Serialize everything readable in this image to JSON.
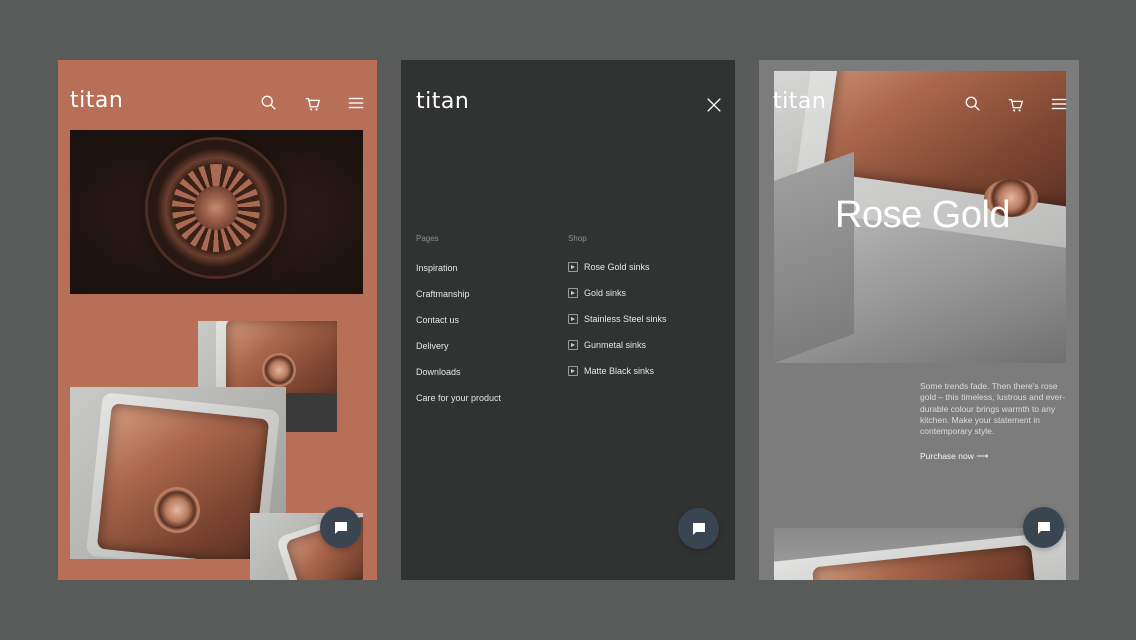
{
  "brand": {
    "logo_text": "titan"
  },
  "panel_product_gallery": {
    "background_color": "#b86f57",
    "icons": [
      "search-icon",
      "cart-icon",
      "hamburger-menu-icon",
      "chat-icon"
    ]
  },
  "panel_menu": {
    "background_color": "#313232",
    "pages_heading": "Pages",
    "pages": [
      {
        "label": "Inspiration"
      },
      {
        "label": "Craftmanship"
      },
      {
        "label": "Contact us"
      },
      {
        "label": "Delivery"
      },
      {
        "label": "Downloads"
      },
      {
        "label": "Care for your product"
      }
    ],
    "shop_heading": "Shop",
    "shop": [
      {
        "label": "Rose Gold sinks"
      },
      {
        "label": "Gold sinks"
      },
      {
        "label": "Stainless Steel sinks"
      },
      {
        "label": "Gunmetal sinks"
      },
      {
        "label": "Matte Black sinks"
      }
    ],
    "icons": [
      "close-icon",
      "chat-icon"
    ]
  },
  "panel_product_detail": {
    "background_color": "#7b7c7b",
    "hero_title": "Rose Gold",
    "description": "Some trends fade. Then there's rose gold – this timeless, lustrous and ever-durable colour brings warmth to any kitchen. Make your statement in contemporary style.",
    "cta": "Purchase now ⟶",
    "icons": [
      "search-icon",
      "cart-icon",
      "hamburger-menu-icon",
      "chat-icon"
    ]
  },
  "colors": {
    "page_background": "#595b5a",
    "chat_button": "#3a4552",
    "rose_gold": "#b87a5f"
  }
}
